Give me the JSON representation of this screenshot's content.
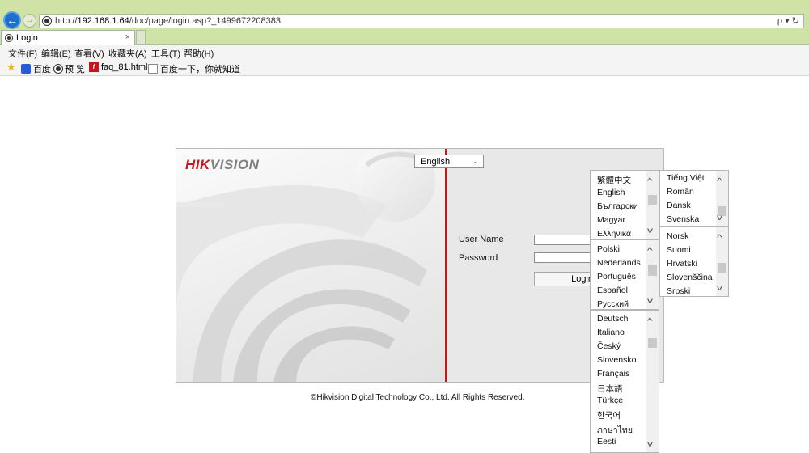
{
  "browser": {
    "url_prefix": "http://",
    "url_host": "192.168.1.64",
    "url_path": "/doc/page/login.asp?_1499672208383",
    "search_glyph": "ρ ▾ ↻",
    "tab_title": "Login",
    "tab_close": "×"
  },
  "menu": [
    "文件(F)",
    "编辑(E)",
    "查看(V)",
    "收藏夹(A)",
    "工具(T)",
    "帮助(H)"
  ],
  "favorites": [
    {
      "icon": "paw-icon",
      "label": "百度"
    },
    {
      "icon": "globe-icon",
      "label": "预 览"
    },
    {
      "icon": "flash-icon",
      "label": "faq_81.html"
    },
    {
      "icon": "page-icon",
      "label": "百度一下，你就知道"
    }
  ],
  "logo": {
    "part1": "HIK",
    "part2": "VISION",
    "red": "#c8161d",
    "grey": "#7f7f7f"
  },
  "login": {
    "username_label": "User Name",
    "password_label": "Password",
    "login_button": "Login",
    "username_value": "",
    "password_value": "",
    "language_selected": "English"
  },
  "copyright": "©Hikvision Digital Technology Co., Ltd. All Rights Reserved.",
  "dropdown_groups": [
    [
      "繁體中文",
      "English",
      "Български",
      "Magyar",
      "Ελληνικά"
    ],
    [
      "Polski",
      "Nederlands",
      "Português",
      "Español",
      "Русский"
    ],
    [
      "Deutsch",
      "Italiano",
      "Český",
      "Slovensko",
      "Français",
      "日本語",
      "Türkçe",
      "한국어",
      "ภาษาไทย",
      "Eesti"
    ],
    [
      "Tiếng Việt",
      "Român",
      "Dansk",
      "Svenska"
    ],
    [
      "Norsk",
      "Suomi",
      "Hrvatski",
      "Slovenščina",
      "Srpski"
    ]
  ],
  "colors": {
    "accent_red": "#c4161c",
    "chrome_green": "#cfe3a6",
    "back_button_blue": "#1f6fd0"
  }
}
